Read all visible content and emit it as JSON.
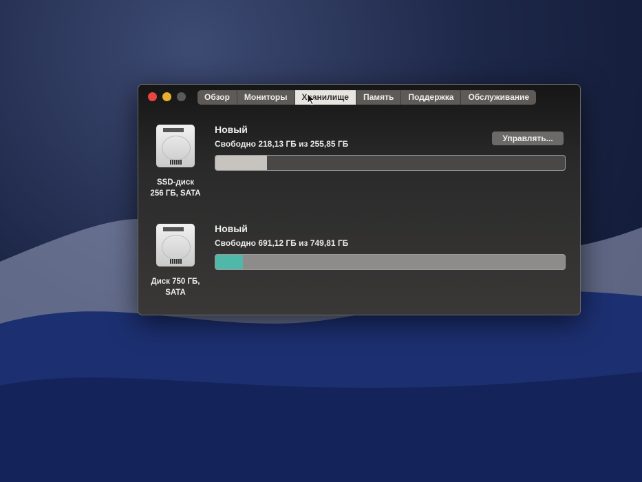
{
  "window": {
    "traffic_lights": {
      "close": "#e8463f",
      "minimize": "#e9b030",
      "zoom": "#5a5a5a"
    },
    "tabs": [
      {
        "label": "Обзор",
        "active": false
      },
      {
        "label": "Мониторы",
        "active": false
      },
      {
        "label": "Хранилище",
        "active": true
      },
      {
        "label": "Память",
        "active": false
      },
      {
        "label": "Поддержка",
        "active": false
      },
      {
        "label": "Обслуживание",
        "active": false
      }
    ],
    "manage_button": "Управлять...",
    "disks": [
      {
        "name_line1": "SSD-диск",
        "name_line2": "256 ГБ, SATA",
        "volume": "Новый",
        "free_text": "Свободно 218,13 ГБ из 255,85 ГБ",
        "used_fraction": 0.147,
        "fill_color": "#c7c3bf",
        "track_color": "#4a4847"
      },
      {
        "name_line1": "Диск 750 ГБ,",
        "name_line2": "SATA",
        "volume": "Новый",
        "free_text": "Свободно 691,12 ГБ из 749,81 ГБ",
        "used_fraction": 0.078,
        "fill_color": "#4fb8a8",
        "track_color": "#8e8c8b"
      }
    ]
  }
}
